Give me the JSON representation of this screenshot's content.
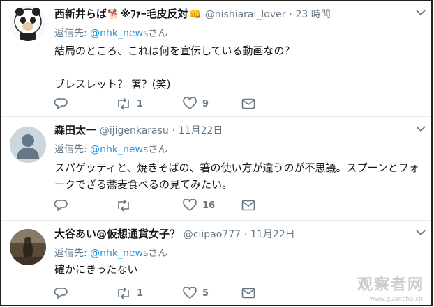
{
  "tweets": [
    {
      "name": "西新井らば",
      "name_suffix": "※ﾌｧｰ毛皮反対",
      "handle": "@nishiarai_lover",
      "time": "23 時間",
      "reply_prefix": "返信先: ",
      "reply_to": "@nhk_news",
      "reply_suffix": "さん",
      "lines": [
        "結局のところ、これは何を宣伝している動画なの？",
        "",
        "ブレスレット？ 箸？(笑)"
      ],
      "reply_count": "",
      "retweet_count": "1",
      "like_count": "9"
    },
    {
      "name": "森田太一",
      "name_suffix": "",
      "handle": "@ijigenkarasu",
      "time": "11月22日",
      "reply_prefix": "返信先: ",
      "reply_to": "@nhk_news",
      "reply_suffix": "さん",
      "lines": [
        "スパゲッティと、焼きそばの、箸の使い方が違うのが不思議。スプーンとフォ",
        "ークでざる蕎麦食べるの見てみたい。"
      ],
      "reply_count": "",
      "retweet_count": "",
      "like_count": "16"
    },
    {
      "name": "大谷あい@仮想通貨女子？",
      "name_suffix": "",
      "handle": "@ciipao777",
      "time": "11月22日",
      "reply_prefix": "返信先: ",
      "reply_to": "@nhk_news",
      "reply_suffix": "さん",
      "lines": [
        "確かにきったない"
      ],
      "reply_count": "",
      "retweet_count": "1",
      "like_count": "5"
    }
  ],
  "separator": "·",
  "watermark": "观察者网",
  "watermark_url": "www.guancha.cn",
  "colors": {
    "text": "#14171a",
    "secondary": "#657786",
    "link": "#1b95e0",
    "divider": "#e6ecf0"
  }
}
